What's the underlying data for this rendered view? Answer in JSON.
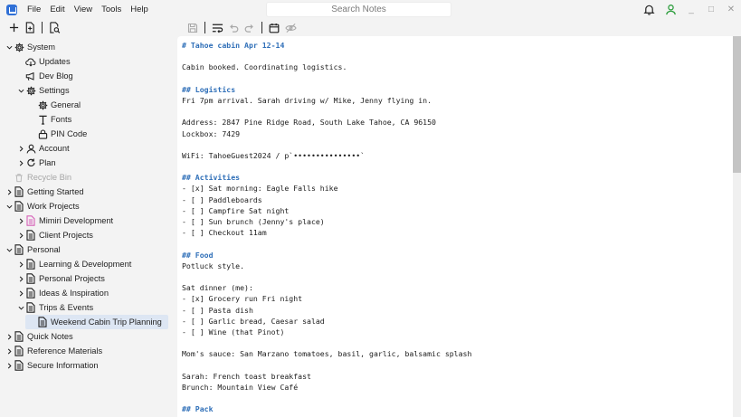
{
  "menu": [
    "File",
    "Edit",
    "View",
    "Tools",
    "Help"
  ],
  "search": {
    "placeholder": "Search Notes"
  },
  "window_controls": {
    "minimize": "_",
    "maximize": "□",
    "close": "✕"
  },
  "sidebar": {
    "items": [
      {
        "label": "System",
        "depth": 0,
        "chevron": "down",
        "icon": "gear-icon"
      },
      {
        "label": "Updates",
        "depth": 1,
        "chevron": "none",
        "icon": "cloud-download-icon"
      },
      {
        "label": "Dev Blog",
        "depth": 1,
        "chevron": "none",
        "icon": "megaphone-icon"
      },
      {
        "label": "Settings",
        "depth": 1,
        "chevron": "down",
        "icon": "gear-icon"
      },
      {
        "label": "General",
        "depth": 2,
        "chevron": "none",
        "icon": "gear-icon"
      },
      {
        "label": "Fonts",
        "depth": 2,
        "chevron": "none",
        "icon": "type-icon"
      },
      {
        "label": "PIN Code",
        "depth": 2,
        "chevron": "none",
        "icon": "lock-icon"
      },
      {
        "label": "Account",
        "depth": 1,
        "chevron": "right",
        "icon": "user-icon"
      },
      {
        "label": "Plan",
        "depth": 1,
        "chevron": "right",
        "icon": "refresh-icon"
      },
      {
        "label": "Recycle Bin",
        "depth": 0,
        "chevron": "none",
        "icon": "trash-icon",
        "muted": true
      },
      {
        "label": "Getting Started",
        "depth": 0,
        "chevron": "right",
        "icon": "document-icon"
      },
      {
        "label": "Work Projects",
        "depth": 0,
        "chevron": "down",
        "icon": "document-icon"
      },
      {
        "label": "Mimiri Development",
        "depth": 1,
        "chevron": "right",
        "icon": "document-pink-icon"
      },
      {
        "label": "Client Projects",
        "depth": 1,
        "chevron": "right",
        "icon": "document-icon"
      },
      {
        "label": "Personal",
        "depth": 0,
        "chevron": "down",
        "icon": "document-icon"
      },
      {
        "label": "Learning & Development",
        "depth": 1,
        "chevron": "right",
        "icon": "document-icon"
      },
      {
        "label": "Personal Projects",
        "depth": 1,
        "chevron": "right",
        "icon": "document-icon"
      },
      {
        "label": "Ideas & Inspiration",
        "depth": 1,
        "chevron": "right",
        "icon": "document-icon"
      },
      {
        "label": "Trips & Events",
        "depth": 1,
        "chevron": "down",
        "icon": "document-icon"
      },
      {
        "label": "Weekend Cabin Trip Planning",
        "depth": 2,
        "chevron": "none",
        "icon": "document-icon",
        "selected": true
      },
      {
        "label": "Quick Notes",
        "depth": 0,
        "chevron": "right",
        "icon": "document-icon"
      },
      {
        "label": "Reference Materials",
        "depth": 0,
        "chevron": "right",
        "icon": "document-icon"
      },
      {
        "label": "Secure Information",
        "depth": 0,
        "chevron": "right",
        "icon": "document-icon"
      }
    ]
  },
  "editor": {
    "lines": [
      {
        "text": "# Tahoe cabin Apr 12-14",
        "style": "heading"
      },
      {
        "text": "",
        "style": "gap"
      },
      {
        "text": "Cabin booked. Coordinating logistics.",
        "style": "plain"
      },
      {
        "text": "",
        "style": "gap"
      },
      {
        "text": "## Logistics",
        "style": "heading"
      },
      {
        "text": "Fri 7pm arrival. Sarah driving w/ Mike, Jenny flying in.",
        "style": "plain"
      },
      {
        "text": "",
        "style": "gap"
      },
      {
        "text": "Address: 2847 Pine Ridge Road, South Lake Tahoe, CA 96150",
        "style": "plain"
      },
      {
        "text": "Lockbox: 7429",
        "style": "plain"
      },
      {
        "text": "",
        "style": "gap"
      },
      {
        "text": "WiFi: TahoeGuest2024 / p`•••••••••••••••`",
        "style": "plain"
      },
      {
        "text": "",
        "style": "gap"
      },
      {
        "text": "## Activities",
        "style": "heading"
      },
      {
        "text": "- [x] Sat morning: Eagle Falls hike",
        "style": "plain"
      },
      {
        "text": "- [ ] Paddleboards",
        "style": "plain"
      },
      {
        "text": "- [ ] Campfire Sat night",
        "style": "plain"
      },
      {
        "text": "- [ ] Sun brunch (Jenny's place)",
        "style": "plain"
      },
      {
        "text": "- [ ] Checkout 11am",
        "style": "plain"
      },
      {
        "text": "",
        "style": "gap"
      },
      {
        "text": "## Food",
        "style": "heading"
      },
      {
        "text": "Potluck style.",
        "style": "plain"
      },
      {
        "text": "",
        "style": "gap"
      },
      {
        "text": "Sat dinner (me):",
        "style": "plain"
      },
      {
        "text": "- [x] Grocery run Fri night",
        "style": "plain"
      },
      {
        "text": "- [ ] Pasta dish",
        "style": "plain"
      },
      {
        "text": "- [ ] Garlic bread, Caesar salad",
        "style": "plain"
      },
      {
        "text": "- [ ] Wine (that Pinot)",
        "style": "plain"
      },
      {
        "text": "",
        "style": "gap"
      },
      {
        "text": "Mom's sauce: San Marzano tomatoes, basil, garlic, balsamic splash",
        "style": "plain"
      },
      {
        "text": "",
        "style": "gap"
      },
      {
        "text": "Sarah: French toast breakfast",
        "style": "plain"
      },
      {
        "text": "Brunch: Mountain View Café",
        "style": "plain"
      },
      {
        "text": "",
        "style": "gap"
      },
      {
        "text": "## Pack",
        "style": "heading"
      }
    ]
  },
  "colors": {
    "accent": "#2f6fd6",
    "heading": "#2f6fb8",
    "selected_bg": "#dde6f3",
    "status_green": "#2e9e3e",
    "doc_pink": "#d65fb8"
  }
}
